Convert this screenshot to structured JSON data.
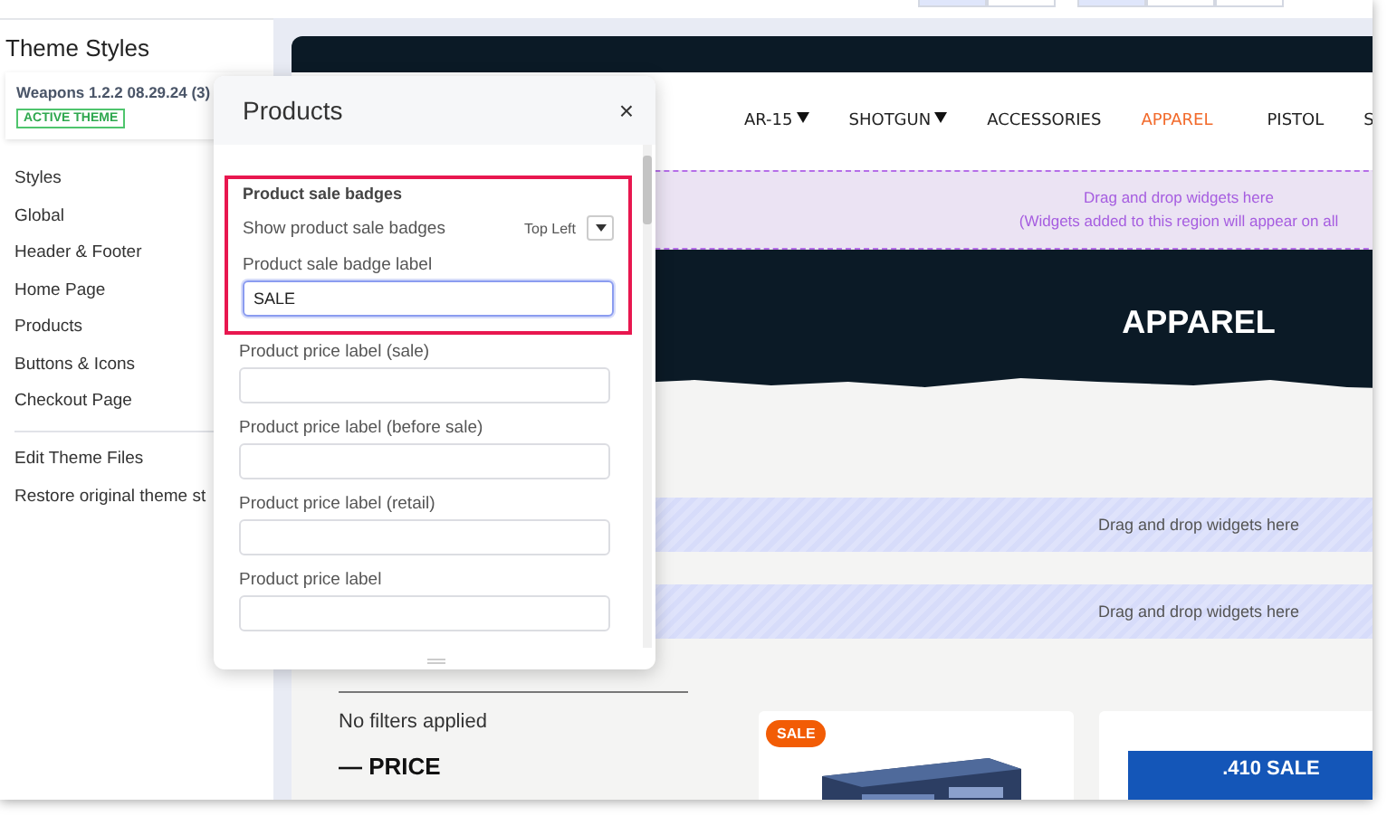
{
  "toolbar": {
    "groups": [
      {
        "buttons": [
          {
            "selected": true
          },
          {
            "selected": false
          }
        ]
      },
      {
        "buttons": [
          {
            "selected": true
          },
          {
            "selected": false
          },
          {
            "selected": false
          }
        ]
      }
    ]
  },
  "sidebar": {
    "title": "Theme Styles",
    "theme": {
      "name": "Weapons 1.2.2 08.29.24 (3)",
      "badge": "ACTIVE THEME"
    },
    "items": [
      "Styles",
      "Global",
      "Header & Footer",
      "Home Page",
      "Products",
      "Buttons & Icons",
      "Checkout Page"
    ],
    "footer_items": [
      "Edit Theme Files",
      "Restore original theme st"
    ]
  },
  "preview": {
    "nav": [
      {
        "label": "AR-15",
        "dropdown": true,
        "selected": false
      },
      {
        "label": "SHOTGUN",
        "dropdown": true,
        "selected": false
      },
      {
        "label": "ACCESSORIES",
        "dropdown": false,
        "selected": false
      },
      {
        "label": "APPAREL",
        "dropdown": false,
        "selected": true
      },
      {
        "label": "PISTOL",
        "dropdown": false,
        "selected": false
      },
      {
        "label": "S",
        "dropdown": false,
        "selected": false
      }
    ],
    "global_region": [
      "Drag and drop widgets here",
      "(Widgets added to this region will appear on all"
    ],
    "hero_title": "APPAREL",
    "widget_regions": [
      "Drag and drop widgets here",
      "Drag and drop widgets here"
    ],
    "filters_text": "No filters applied",
    "price_heading": "— PRICE",
    "products": [
      {
        "badge": "SALE"
      },
      {
        "kind": "banner",
        "banner": ".410 SALE"
      }
    ]
  },
  "modal": {
    "title": "Products",
    "close": "×",
    "section": {
      "heading": "Product sale badges",
      "setting_label": "Show product sale badges",
      "setting_value": "Top Left",
      "highlighted": true
    },
    "fields": [
      {
        "label": "Product sale badge label",
        "value": "SALE",
        "focused": true
      },
      {
        "label": "Product price label (sale)",
        "focused": false
      },
      {
        "label": "Product price label (before sale)",
        "focused": false
      },
      {
        "label": "Product price label (retail)",
        "focused": false
      },
      {
        "label": "Product price label",
        "focused": false
      }
    ]
  }
}
